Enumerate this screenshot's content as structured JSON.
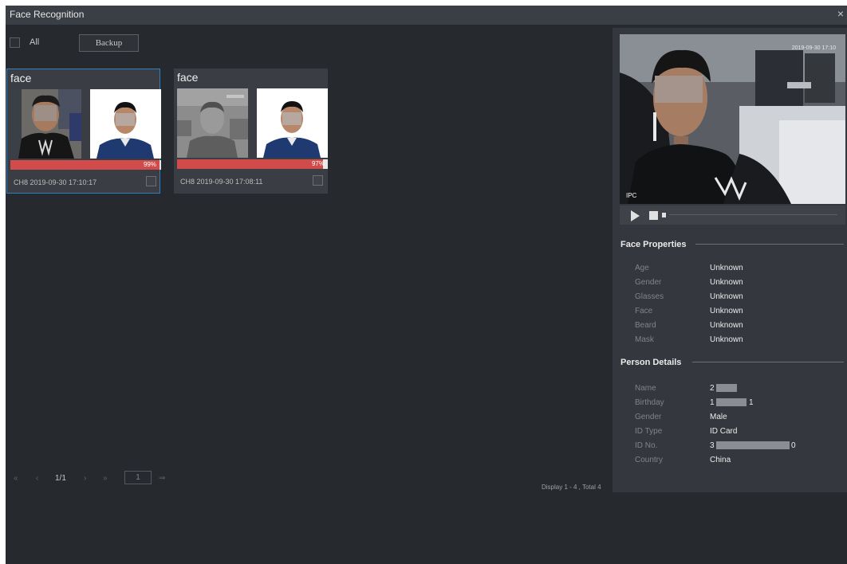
{
  "window": {
    "title": "Face Recognition",
    "close_glyph": "×"
  },
  "toolbar": {
    "all_label": "All",
    "backup_label": "Backup"
  },
  "results": [
    {
      "title": "face",
      "similarity": "99%",
      "similarity_value": 0.99,
      "info": "CH8 2019-09-30 17:10:17",
      "selected": true
    },
    {
      "title": "face",
      "similarity": "97%",
      "similarity_value": 0.97,
      "info": "CH8 2019-09-30 17:08:11",
      "selected": false
    }
  ],
  "pagination": {
    "first": "«",
    "prev": "‹",
    "page": "1/1",
    "next": "›",
    "last": "»",
    "page_input": "1",
    "go": "⇒"
  },
  "display_total": "Display 1 - 4 , Total 4",
  "video": {
    "ipc_label": "IPC",
    "osd_text": "2019-09-30 17:10"
  },
  "face_properties": {
    "heading": "Face Properties",
    "items": [
      {
        "label": "Age",
        "value": "Unknown"
      },
      {
        "label": "Gender",
        "value": "Unknown"
      },
      {
        "label": "Glasses",
        "value": "Unknown"
      },
      {
        "label": "Face",
        "value": "Unknown"
      },
      {
        "label": "Beard",
        "value": "Unknown"
      },
      {
        "label": "Mask",
        "value": "Unknown"
      }
    ]
  },
  "person_details": {
    "heading": "Person Details",
    "items": [
      {
        "label": "Name",
        "value": "2"
      },
      {
        "label": "Birthday",
        "value": "1"
      },
      {
        "label": "Gender",
        "value": "Male"
      },
      {
        "label": "ID Type",
        "value": "ID Card"
      },
      {
        "label": "ID No.",
        "value": "3"
      },
      {
        "label": "Country",
        "value": "China"
      }
    ],
    "birthday_suffix": "1",
    "id_suffix": "0"
  },
  "colors": {
    "background": "#26292e",
    "panel": "#34373d",
    "accent_selected": "#2f7fc1",
    "similarity_bar": "#d24b4b"
  }
}
